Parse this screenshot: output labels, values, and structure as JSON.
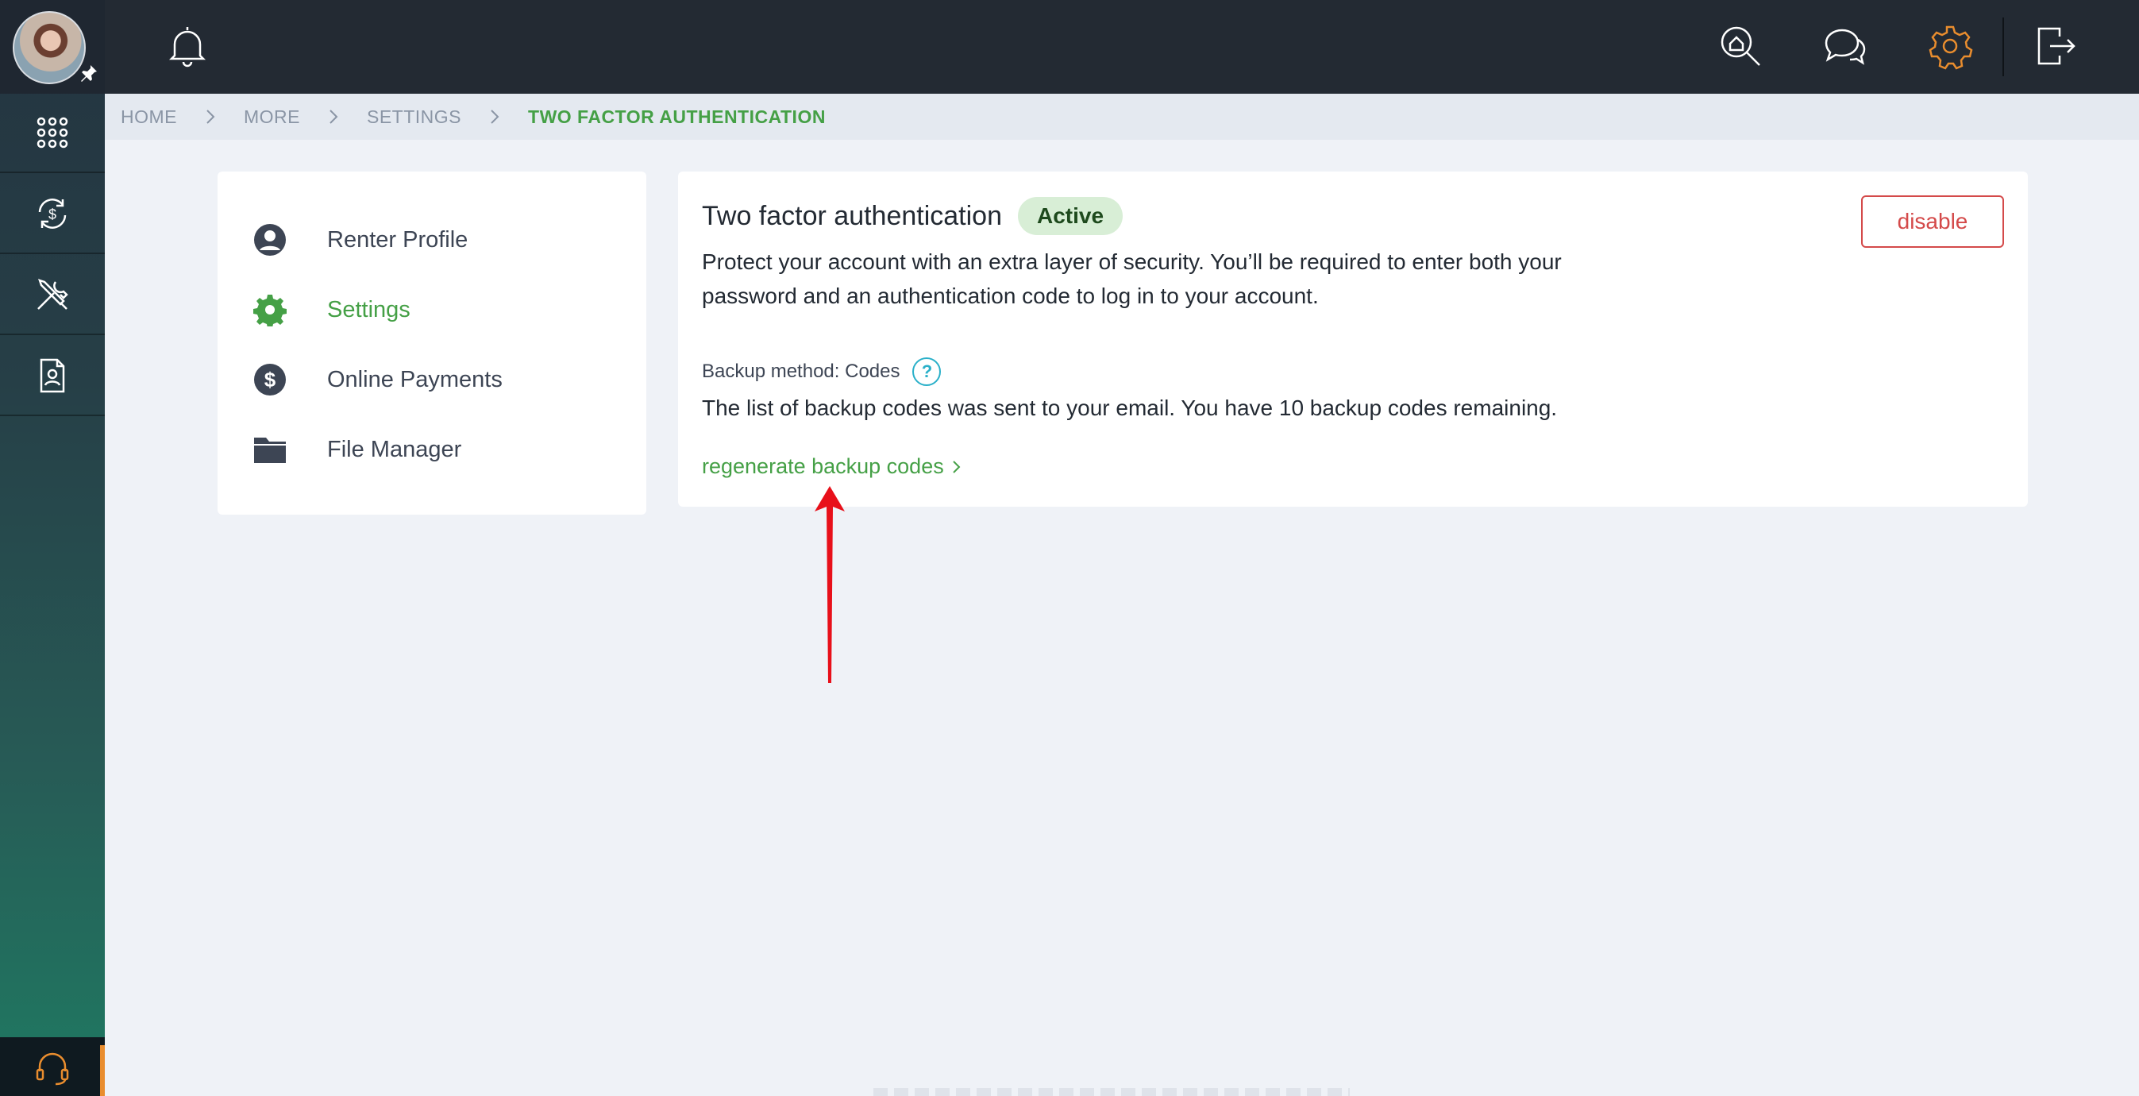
{
  "topbar": {
    "icons": [
      "bell-icon",
      "search-home-icon",
      "chat-icon",
      "gear-icon",
      "logout-icon"
    ],
    "accent_color": "#e98d2e"
  },
  "rail": {
    "icons": [
      "apps-grid-icon",
      "payments-cycle-icon",
      "tools-icon",
      "tenant-document-icon",
      "support-headset-icon"
    ]
  },
  "breadcrumb": {
    "items": [
      "HOME",
      "MORE",
      "SETTINGS"
    ],
    "current": "TWO FACTOR AUTHENTICATION"
  },
  "menu": {
    "items": [
      {
        "label": "Renter Profile",
        "icon": "user-circle-icon"
      },
      {
        "label": "Settings",
        "icon": "gear-icon"
      },
      {
        "label": "Online Payments",
        "icon": "dollar-circle-icon"
      },
      {
        "label": "File Manager",
        "icon": "folder-icon"
      }
    ],
    "active_color": "#45a046"
  },
  "twofa": {
    "title": "Two factor authentication",
    "status": "Active",
    "disable_label": "disable",
    "description": "Protect your account with an extra layer of security. You’ll be required to enter both your password and an authentication code to log in to your account.",
    "backup_label": "Backup method: Codes",
    "help_symbol": "?",
    "backup_text": "The list of backup codes was sent to your email. You have 10 backup codes remaining.",
    "regenerate_label": "regenerate backup codes"
  }
}
